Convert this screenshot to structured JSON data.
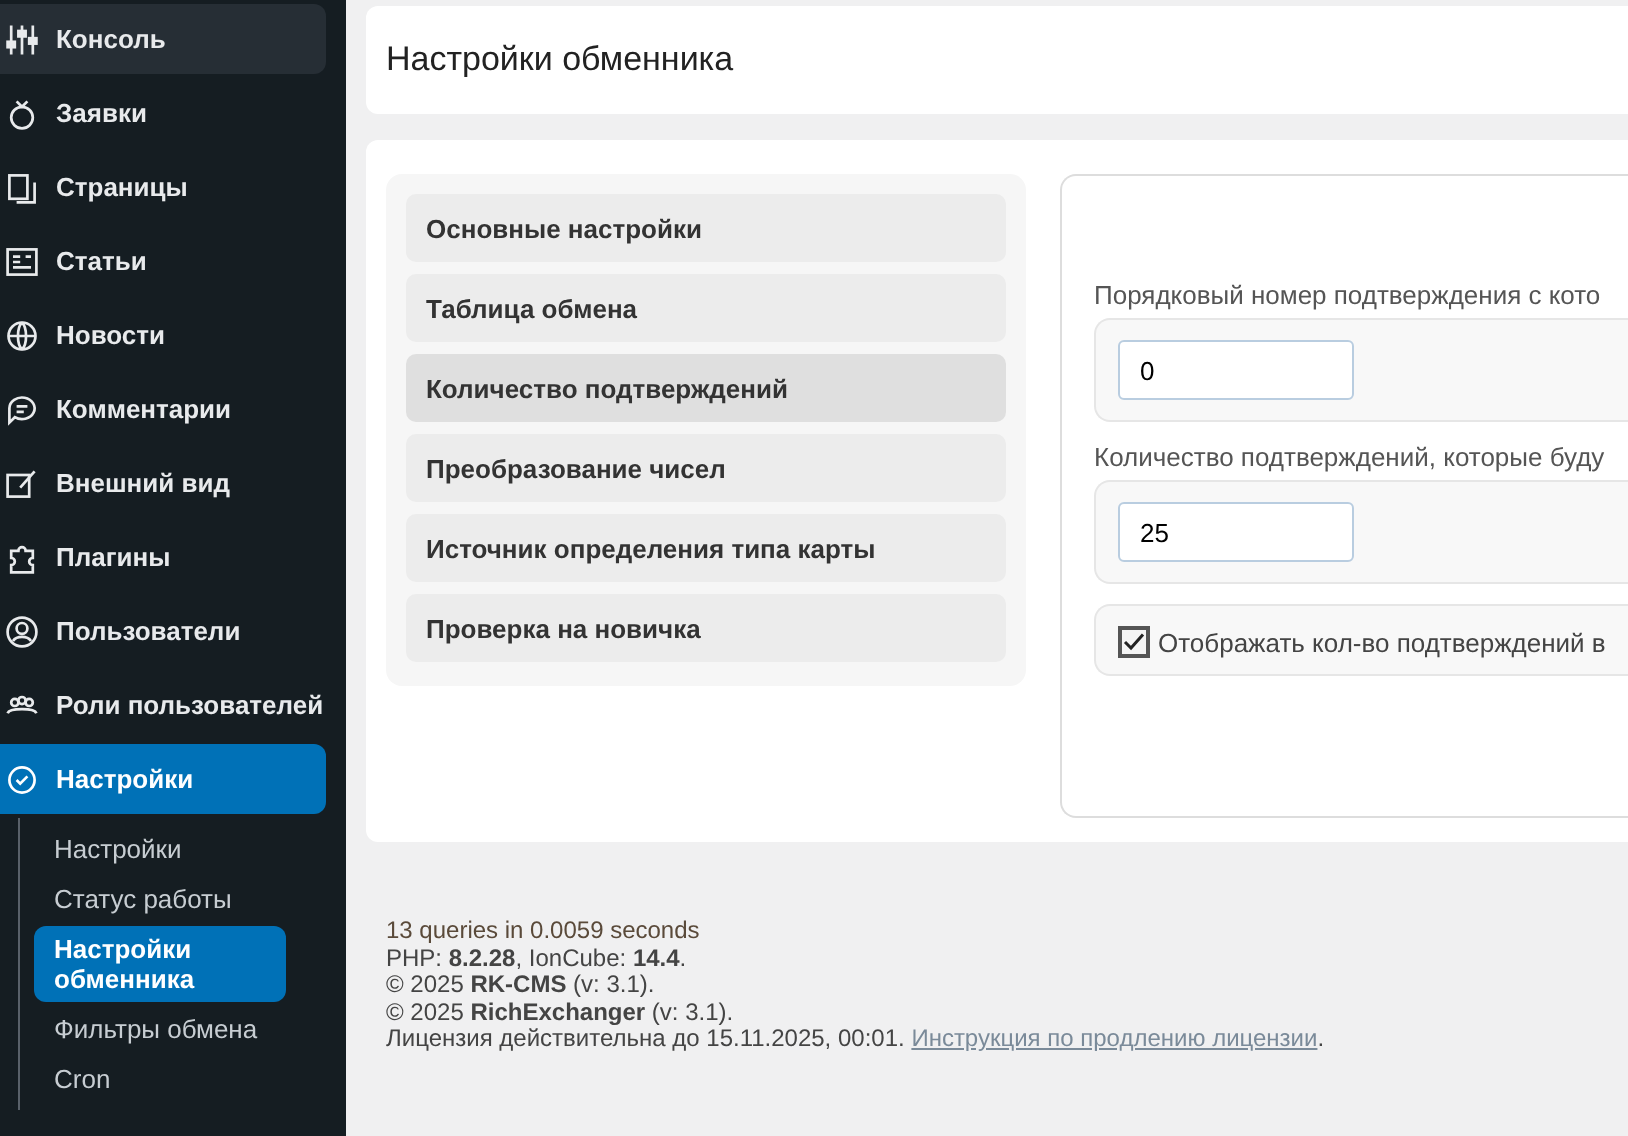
{
  "sidebar": {
    "items": [
      {
        "label": "Консоль",
        "selected": false,
        "hovered": true
      },
      {
        "label": "Заявки",
        "selected": false,
        "hovered": false
      },
      {
        "label": "Страницы",
        "selected": false,
        "hovered": false
      },
      {
        "label": "Статьи",
        "selected": false,
        "hovered": false
      },
      {
        "label": "Новости",
        "selected": false,
        "hovered": false
      },
      {
        "label": "Комментарии",
        "selected": false,
        "hovered": false
      },
      {
        "label": "Внешний вид",
        "selected": false,
        "hovered": false
      },
      {
        "label": "Плагины",
        "selected": false,
        "hovered": false
      },
      {
        "label": "Пользователи",
        "selected": false,
        "hovered": false
      },
      {
        "label": "Роли пользователей",
        "selected": false,
        "hovered": false
      },
      {
        "label": "Настройки",
        "selected": true,
        "hovered": false,
        "children": [
          {
            "label": "Настройки",
            "selected": false
          },
          {
            "label": "Статус работы",
            "selected": false
          },
          {
            "label": "Настройки обменника",
            "selected": true
          },
          {
            "label": "Фильтры обмена",
            "selected": false
          },
          {
            "label": "Cron",
            "selected": false
          }
        ]
      }
    ]
  },
  "page_title": "Настройки обменника",
  "settings_menu": [
    {
      "label": "Основные настройки",
      "selected": false
    },
    {
      "label": "Таблица обмена",
      "selected": false
    },
    {
      "label": "Количество подтверждений",
      "selected": true
    },
    {
      "label": "Преобразование чисел",
      "selected": false
    },
    {
      "label": "Источник определения типа карты",
      "selected": false
    },
    {
      "label": "Проверка на новичка",
      "selected": false
    }
  ],
  "fields": [
    {
      "kind": "input",
      "label": "Порядковый номер подтверждения с кото",
      "value": "0"
    },
    {
      "kind": "input",
      "label": "Количество подтверждений, которые буду",
      "value": "25"
    },
    {
      "kind": "checkbox",
      "label": "Отображать кол-во подтверждений в",
      "checked": true
    }
  ],
  "footer": {
    "lines": [
      "13 queries in 0.0059 seconds",
      "PHP: **8.2.28**, IonCube: **14.4**.",
      "© 2025 **RK-CMS** (v: 3.1).",
      "© 2025 **RichExchanger** (v: 3.1)."
    ],
    "license": "Лицензия действительна до 15.11.2025, 00:01.",
    "license_link": "Инструкция по продлению лицензии",
    "license_end": "."
  }
}
